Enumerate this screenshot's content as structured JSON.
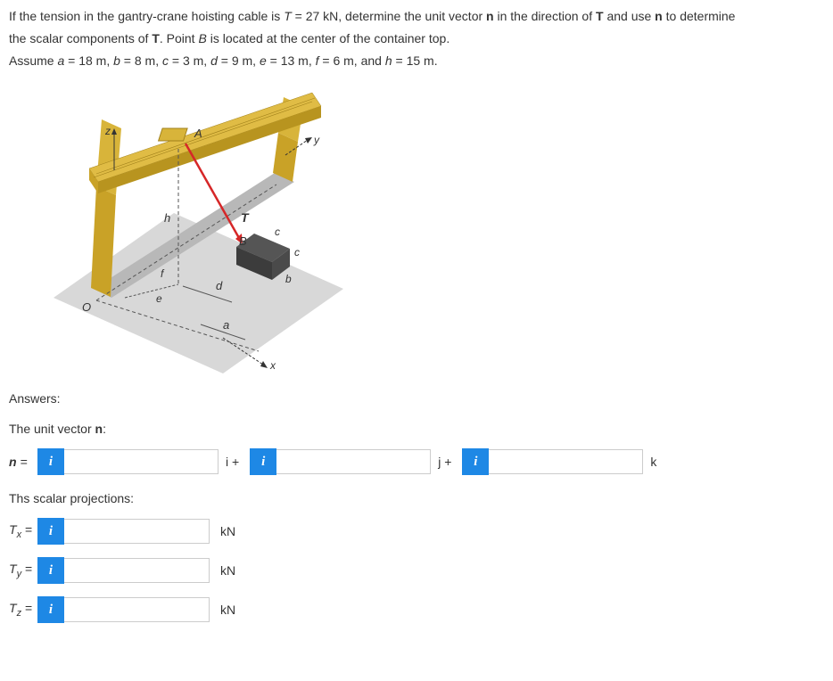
{
  "problem": {
    "line1a": "If the tension in the gantry-crane hoisting cable is ",
    "t_var": "T",
    "t_eq": " = 27 kN, determine the unit vector ",
    "n_var": "n",
    "line1b": " in the direction of ",
    "t_bold": "T",
    "line1c": " and use ",
    "n_var2": "n",
    "line1d": " to determine",
    "line2a": "the scalar components of ",
    "t_bold2": "T",
    "line2b": ". Point ",
    "b_var": "B",
    "line2c": " is located at the center of the container top.",
    "line3a": "Assume ",
    "a_var": "a",
    "a_val": " = 18 m, ",
    "b_var2": "b",
    "b_val": " = 8 m, ",
    "c_var": "c",
    "c_val": " = 3 m, ",
    "d_var": "d",
    "d_val": " = 9 m, ",
    "e_var": "e",
    "e_val": " = 13 m, ",
    "f_var": "f",
    "f_val": " = 6 m, and ",
    "h_var": "h",
    "h_val": " = 15 m."
  },
  "labels": {
    "answers": "Answers:",
    "unit_vector": "The unit vector ",
    "unit_vector_n": "n",
    "unit_vector_suffix": ":",
    "scalar_proj": "Ths scalar projections:",
    "n_eq": "n",
    "eq": " = ",
    "i_plus": "i + ",
    "j_plus": "j + ",
    "k": "k",
    "Tx": "T",
    "Tx_sub": "x",
    "Ty_sub": "y",
    "Tz_sub": "z",
    "kN": "kN"
  },
  "figure": {
    "z": "z",
    "y": "y",
    "x": "x",
    "A": "A",
    "B": "B",
    "O": "O",
    "T": "T",
    "a": "a",
    "b": "b",
    "c": "c",
    "c2": "c",
    "d": "d",
    "e": "e",
    "f": "f",
    "h": "h"
  },
  "info_glyph": "i"
}
